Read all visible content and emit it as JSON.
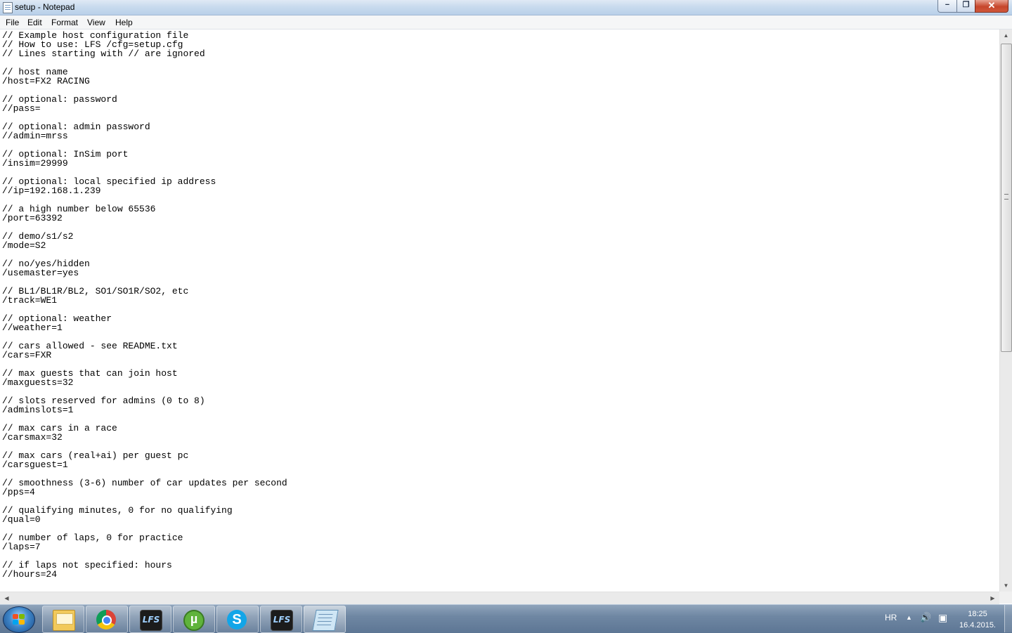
{
  "window": {
    "title": "setup - Notepad",
    "minimize_glyph": "−",
    "maximize_glyph": "❐",
    "close_glyph": "✕"
  },
  "menu": {
    "file": "File",
    "edit": "Edit",
    "format": "Format",
    "view": "View",
    "help": "Help"
  },
  "document": {
    "text": "// Example host configuration file\n// How to use: LFS /cfg=setup.cfg\n// Lines starting with // are ignored\n\n// host name\n/host=FX2 RACING\n\n// optional: password\n//pass=\n\n// optional: admin password\n//admin=mrss\n\n// optional: InSim port\n/insim=29999\n\n// optional: local specified ip address\n//ip=192.168.1.239\n\n// a high number below 65536\n/port=63392\n\n// demo/s1/s2\n/mode=S2\n\n// no/yes/hidden\n/usemaster=yes\n\n// BL1/BL1R/BL2, SO1/SO1R/SO2, etc\n/track=WE1\n\n// optional: weather\n//weather=1\n\n// cars allowed - see README.txt\n/cars=FXR\n\n// max guests that can join host\n/maxguests=32\n\n// slots reserved for admins (0 to 8)\n/adminslots=1\n\n// max cars in a race\n/carsmax=32\n\n// max cars (real+ai) per guest pc\n/carsguest=1\n\n// smoothness (3-6) number of car updates per second\n/pps=4\n\n// qualifying minutes, 0 for no qualifying\n/qual=0\n\n// number of laps, 0 for practice\n/laps=7\n\n// if laps not specified: hours\n//hours=24"
  },
  "scrollbars": {
    "up_arrow": "▲",
    "down_arrow": "▼",
    "left_arrow": "◀",
    "right_arrow": "▶"
  },
  "taskbar": {
    "apps": [
      "windows-explorer",
      "google-chrome",
      "live-for-speed",
      "utorrent",
      "skype",
      "live-for-speed",
      "notepad"
    ],
    "language": "HR",
    "tray_expand": "▲",
    "volume_glyph": "🔊",
    "network_glyph": "▣",
    "time": "18:25",
    "date": "16.4.2015."
  }
}
